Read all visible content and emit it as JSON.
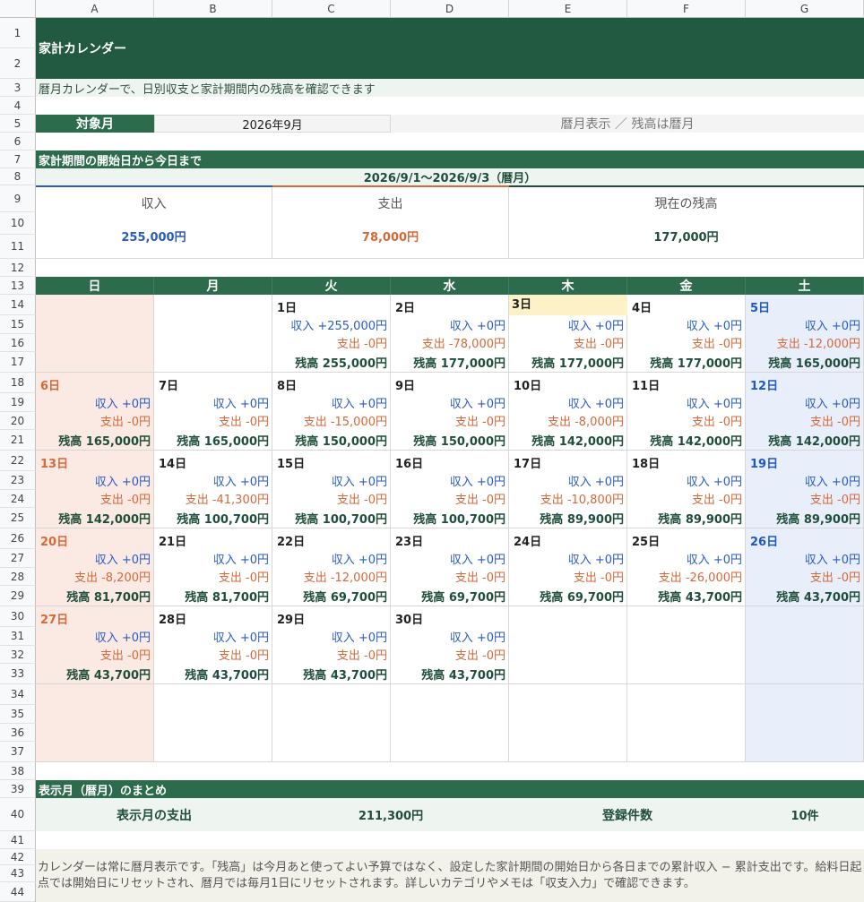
{
  "columns": [
    "A",
    "B",
    "C",
    "D",
    "E",
    "F",
    "G"
  ],
  "rows": [
    "1",
    "2",
    "3",
    "4",
    "5",
    "6",
    "7",
    "8",
    "9",
    "10",
    "11",
    "12",
    "13",
    "14",
    "15",
    "16",
    "17",
    "18",
    "19",
    "20",
    "21",
    "22",
    "23",
    "24",
    "25",
    "26",
    "27",
    "28",
    "29",
    "30",
    "31",
    "32",
    "33",
    "34",
    "35",
    "36",
    "37",
    "38",
    "39",
    "40",
    "41",
    "42",
    "43",
    "44"
  ],
  "title": "家計カレンダー",
  "subtitle": "暦月カレンダーで、日別収支と家計期間内の残高を確認できます",
  "target_month": {
    "label": "対象月",
    "value": "2026年9月",
    "note": "暦月表示 ／ 残高は暦月"
  },
  "period": {
    "heading": "家計期間の開始日から今日まで",
    "range": "2026/9/1〜2026/9/3（暦月）",
    "income_label": "収入",
    "income_value": "255,000円",
    "expense_label": "支出",
    "expense_value": "78,000円",
    "balance_label": "現在の残高",
    "balance_value": "177,000円"
  },
  "colors": {
    "dark_green": "#2c6b4c",
    "income_blue": "#2a5bc2",
    "expense_orange": "#d4693a",
    "balance_green": "#1f4e3a",
    "sunday_bg": "#fbe9e3",
    "saturday_bg": "#e8effb",
    "today_bg": "#fdf1c7"
  },
  "weekdays": [
    "日",
    "月",
    "火",
    "水",
    "木",
    "金",
    "土"
  ],
  "weeks": [
    [
      null,
      null,
      {
        "day": "1日",
        "inc": "収入 +255,000円",
        "exp": "支出 -0円",
        "bal": "残高 255,000円"
      },
      {
        "day": "2日",
        "inc": "収入 +0円",
        "exp": "支出 -78,000円",
        "bal": "残高 177,000円"
      },
      {
        "day": "3日",
        "inc": "収入 +0円",
        "exp": "支出 -0円",
        "bal": "残高 177,000円",
        "today": true
      },
      {
        "day": "4日",
        "inc": "収入 +0円",
        "exp": "支出 -0円",
        "bal": "残高 177,000円"
      },
      {
        "day": "5日",
        "inc": "収入 +0円",
        "exp": "支出 -12,000円",
        "bal": "残高 165,000円"
      }
    ],
    [
      {
        "day": "6日",
        "inc": "収入 +0円",
        "exp": "支出 -0円",
        "bal": "残高 165,000円"
      },
      {
        "day": "7日",
        "inc": "収入 +0円",
        "exp": "支出 -0円",
        "bal": "残高 165,000円"
      },
      {
        "day": "8日",
        "inc": "収入 +0円",
        "exp": "支出 -15,000円",
        "bal": "残高 150,000円"
      },
      {
        "day": "9日",
        "inc": "収入 +0円",
        "exp": "支出 -0円",
        "bal": "残高 150,000円"
      },
      {
        "day": "10日",
        "inc": "収入 +0円",
        "exp": "支出 -8,000円",
        "bal": "残高 142,000円"
      },
      {
        "day": "11日",
        "inc": "収入 +0円",
        "exp": "支出 -0円",
        "bal": "残高 142,000円"
      },
      {
        "day": "12日",
        "inc": "収入 +0円",
        "exp": "支出 -0円",
        "bal": "残高 142,000円"
      }
    ],
    [
      {
        "day": "13日",
        "inc": "収入 +0円",
        "exp": "支出 -0円",
        "bal": "残高 142,000円"
      },
      {
        "day": "14日",
        "inc": "収入 +0円",
        "exp": "支出 -41,300円",
        "bal": "残高 100,700円"
      },
      {
        "day": "15日",
        "inc": "収入 +0円",
        "exp": "支出 -0円",
        "bal": "残高 100,700円"
      },
      {
        "day": "16日",
        "inc": "収入 +0円",
        "exp": "支出 -0円",
        "bal": "残高 100,700円"
      },
      {
        "day": "17日",
        "inc": "収入 +0円",
        "exp": "支出 -10,800円",
        "bal": "残高 89,900円"
      },
      {
        "day": "18日",
        "inc": "収入 +0円",
        "exp": "支出 -0円",
        "bal": "残高 89,900円"
      },
      {
        "day": "19日",
        "inc": "収入 +0円",
        "exp": "支出 -0円",
        "bal": "残高 89,900円"
      }
    ],
    [
      {
        "day": "20日",
        "inc": "収入 +0円",
        "exp": "支出 -8,200円",
        "bal": "残高 81,700円"
      },
      {
        "day": "21日",
        "inc": "収入 +0円",
        "exp": "支出 -0円",
        "bal": "残高 81,700円"
      },
      {
        "day": "22日",
        "inc": "収入 +0円",
        "exp": "支出 -12,000円",
        "bal": "残高 69,700円"
      },
      {
        "day": "23日",
        "inc": "収入 +0円",
        "exp": "支出 -0円",
        "bal": "残高 69,700円"
      },
      {
        "day": "24日",
        "inc": "収入 +0円",
        "exp": "支出 -0円",
        "bal": "残高 69,700円"
      },
      {
        "day": "25日",
        "inc": "収入 +0円",
        "exp": "支出 -26,000円",
        "bal": "残高 43,700円"
      },
      {
        "day": "26日",
        "inc": "収入 +0円",
        "exp": "支出 -0円",
        "bal": "残高 43,700円"
      }
    ],
    [
      {
        "day": "27日",
        "inc": "収入 +0円",
        "exp": "支出 -0円",
        "bal": "残高 43,700円"
      },
      {
        "day": "28日",
        "inc": "収入 +0円",
        "exp": "支出 -0円",
        "bal": "残高 43,700円"
      },
      {
        "day": "29日",
        "inc": "収入 +0円",
        "exp": "支出 -0円",
        "bal": "残高 43,700円"
      },
      {
        "day": "30日",
        "inc": "収入 +0円",
        "exp": "支出 -0円",
        "bal": "残高 43,700円"
      },
      null,
      null,
      null
    ],
    [
      null,
      null,
      null,
      null,
      null,
      null,
      null
    ]
  ],
  "month_summary": {
    "heading": "表示月（暦月）のまとめ",
    "expense_label": "表示月の支出",
    "expense_value": "211,300円",
    "count_label": "登録件数",
    "count_value": "10件"
  },
  "footnote": "カレンダーは常に暦月表示です。「残高」は今月あと使ってよい予算ではなく、設定した家計期間の開始日から各日までの累計収入 − 累計支出です。給料日起点では開始日にリセットされ、暦月では毎月1日にリセットされます。詳しいカテゴリやメモは「収支入力」で確認できます。"
}
